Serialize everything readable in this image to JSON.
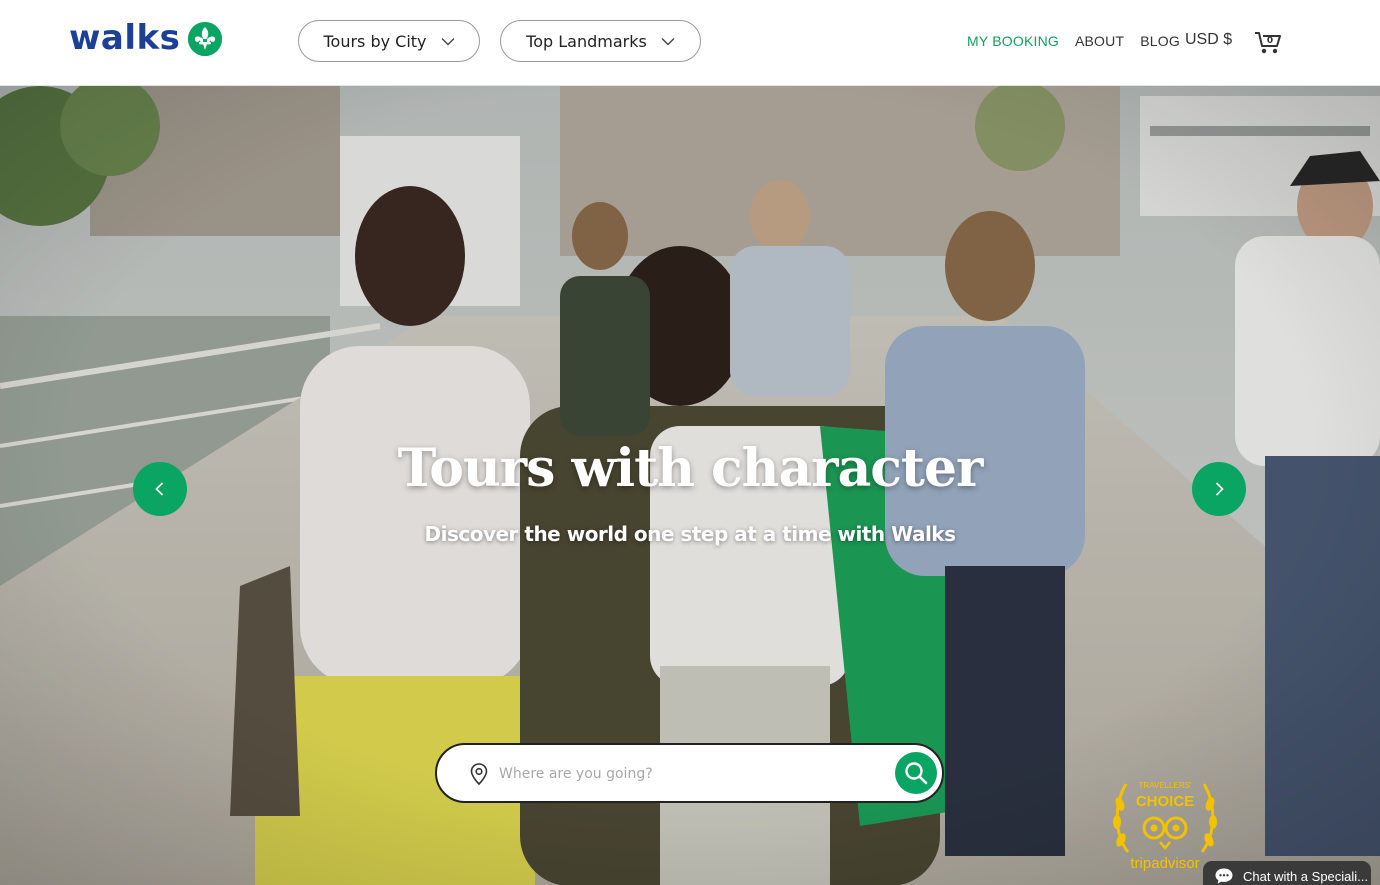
{
  "brand": {
    "logo_text": "walks",
    "logo_icon": "fleur-de-lis-icon",
    "accent": "#0aa562",
    "logo_color": "#1d3f95"
  },
  "header": {
    "nav_pills": [
      {
        "label": "Tours by City",
        "icon": "chevron-down-icon"
      },
      {
        "label": "Top Landmarks",
        "icon": "chevron-down-icon"
      }
    ],
    "links": [
      {
        "label": "MY BOOKING",
        "active": true
      },
      {
        "label": "ABOUT",
        "active": false
      },
      {
        "label": "BLOG",
        "active": false
      }
    ],
    "currency": "USD $",
    "cart_icon": "shopping-cart-icon"
  },
  "hero": {
    "title": "Tours with character",
    "subtitle": "Discover the world one step at a time with Walks",
    "prev_icon": "chevron-left-icon",
    "next_icon": "chevron-right-icon",
    "search": {
      "placeholder": "Where are you going?",
      "value": "",
      "pin_icon": "map-pin-icon",
      "button_icon": "search-icon"
    },
    "badge": {
      "top_text": "TRAVELLERS'",
      "middle_text": "CHOICE",
      "bottom_text": "tripadvisor",
      "color": "#f2c200"
    }
  },
  "chat": {
    "label": "Chat with a Speciali...",
    "icon": "chat-bubble-icon"
  }
}
